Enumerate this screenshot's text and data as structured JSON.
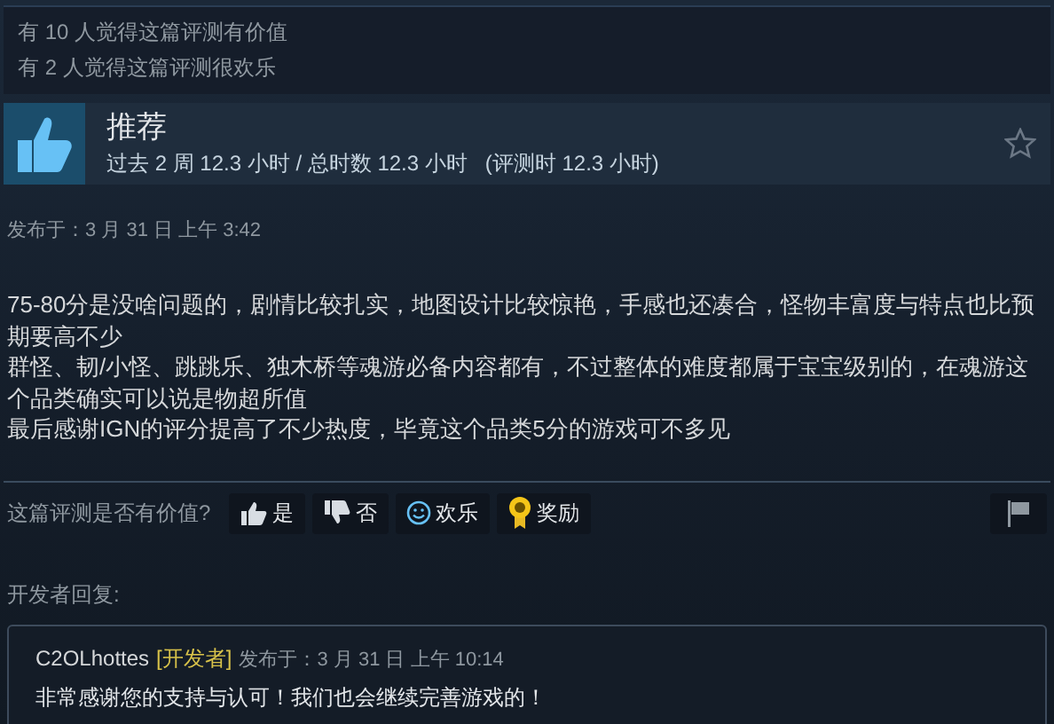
{
  "votes_summary": [
    "有 10 人觉得这篇评测有价值",
    "有 2 人觉得这篇评测很欢乐"
  ],
  "review": {
    "verdict": "推荐",
    "recommended": true,
    "playtime": "过去 2 周 12.3 小时 / 总时数 12.3 小时",
    "playtime_at_review": "(评测时 12.3 小时)",
    "posted": "发布于：3 月 31 日 上午 3:42",
    "paragraphs": [
      "75-80分是没啥问题的，剧情比较扎实，地图设计比较惊艳，手感也还凑合，怪物丰富度与特点也比预期要高不少",
      "群怪、韧/小怪、跳跳乐、独木桥等魂游必备内容都有，不过整体的难度都属于宝宝级别的，在魂游这个品类确实可以说是物超所值",
      "最后感谢IGN的评分提高了不少热度，毕竟这个品类5分的游戏可不多见"
    ]
  },
  "helpful_prompt": "这篇评测是否有价值?",
  "rate_buttons": [
    {
      "kind": "yes",
      "label": "是"
    },
    {
      "kind": "no",
      "label": "否"
    },
    {
      "kind": "funny",
      "label": "欢乐"
    },
    {
      "kind": "award",
      "label": "奖励"
    }
  ],
  "developer_reply": {
    "heading": "开发者回复:",
    "author": "C2OLhottes",
    "badge": "[开发者]",
    "posted": "发布于：3 月 31 日 上午 10:14",
    "text": "非常感谢您的支持与认可！我们也会继续完善游戏的！"
  }
}
